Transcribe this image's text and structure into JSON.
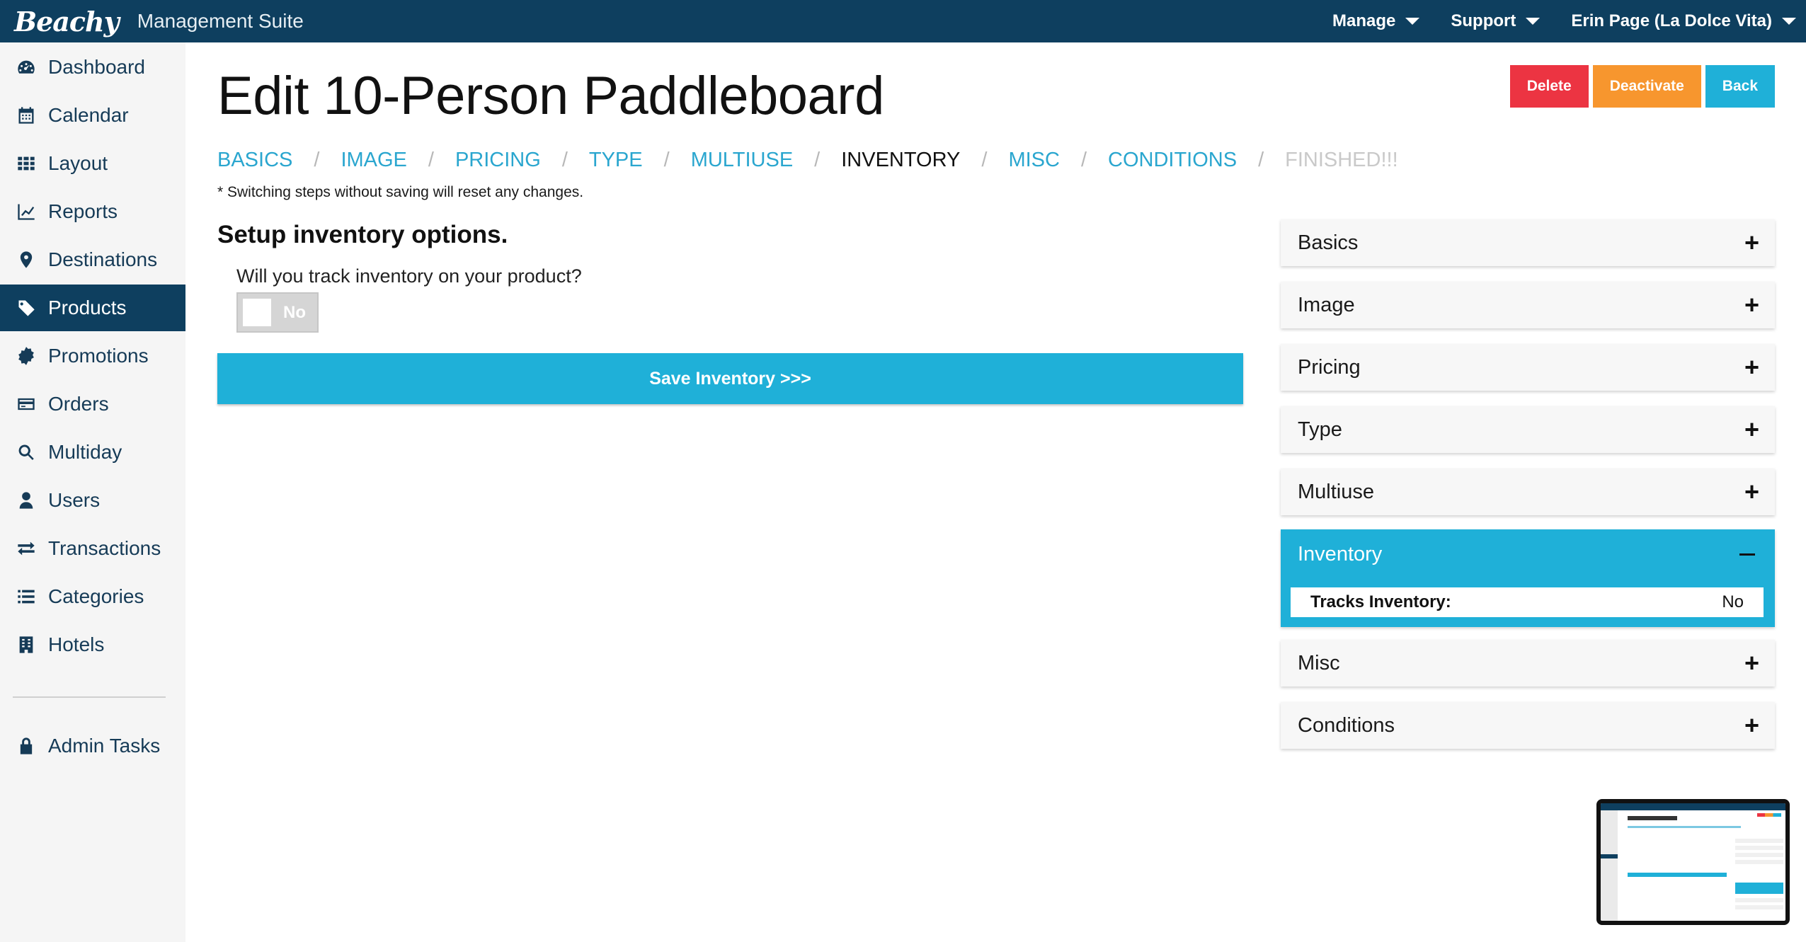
{
  "app": {
    "logo": "Beachy",
    "suite": "Management Suite"
  },
  "topnav": [
    {
      "label": "Manage"
    },
    {
      "label": "Support"
    },
    {
      "label": "Erin Page (La Dolce Vita)"
    }
  ],
  "sidebar": {
    "items": [
      {
        "label": "Dashboard",
        "icon": "dashboard-gauge-icon"
      },
      {
        "label": "Calendar",
        "icon": "calendar-icon"
      },
      {
        "label": "Layout",
        "icon": "grid-icon"
      },
      {
        "label": "Reports",
        "icon": "line-chart-icon"
      },
      {
        "label": "Destinations",
        "icon": "map-pin-icon"
      },
      {
        "label": "Products",
        "icon": "tag-icon",
        "active": true
      },
      {
        "label": "Promotions",
        "icon": "badge-icon"
      },
      {
        "label": "Orders",
        "icon": "credit-card-icon"
      },
      {
        "label": "Multiday",
        "icon": "search-icon"
      },
      {
        "label": "Users",
        "icon": "user-icon"
      },
      {
        "label": "Transactions",
        "icon": "exchange-arrows-icon"
      },
      {
        "label": "Categories",
        "icon": "list-icon"
      },
      {
        "label": "Hotels",
        "icon": "building-icon"
      },
      {
        "label": "Admin Tasks",
        "icon": "lock-icon"
      }
    ]
  },
  "page": {
    "title": "Edit 10-Person Paddleboard",
    "actions": {
      "delete": "Delete",
      "deactivate": "Deactivate",
      "back": "Back"
    },
    "steps": [
      {
        "label": "BASICS",
        "state": "link"
      },
      {
        "label": "IMAGE",
        "state": "link"
      },
      {
        "label": "PRICING",
        "state": "link"
      },
      {
        "label": "TYPE",
        "state": "link"
      },
      {
        "label": "MULTIUSE",
        "state": "link"
      },
      {
        "label": "INVENTORY",
        "state": "current"
      },
      {
        "label": "MISC",
        "state": "link"
      },
      {
        "label": "CONDITIONS",
        "state": "link"
      },
      {
        "label": "FINISHED!!!",
        "state": "disabled"
      }
    ],
    "step_separator": "/",
    "note": "* Switching steps without saving will reset any changes.",
    "setup_title": "Setup inventory options.",
    "question": "Will you track inventory on your product?",
    "toggle": {
      "value": "No",
      "on": false
    },
    "save_button": "Save Inventory >>>"
  },
  "accordion": {
    "panels": [
      {
        "label": "Basics",
        "expanded": false
      },
      {
        "label": "Image",
        "expanded": false
      },
      {
        "label": "Pricing",
        "expanded": false
      },
      {
        "label": "Type",
        "expanded": false
      },
      {
        "label": "Multiuse",
        "expanded": false
      },
      {
        "label": "Inventory",
        "expanded": true
      },
      {
        "label": "Misc",
        "expanded": false
      },
      {
        "label": "Conditions",
        "expanded": false
      }
    ],
    "inventory_detail": {
      "key": "Tracks Inventory:",
      "value": "No"
    },
    "plus_glyph": "+"
  },
  "colors": {
    "topbar": "#0e3f5f",
    "accent": "#1fb0d8",
    "danger": "#ec3442",
    "warning": "#f7962e",
    "link": "#2aa6cf"
  }
}
